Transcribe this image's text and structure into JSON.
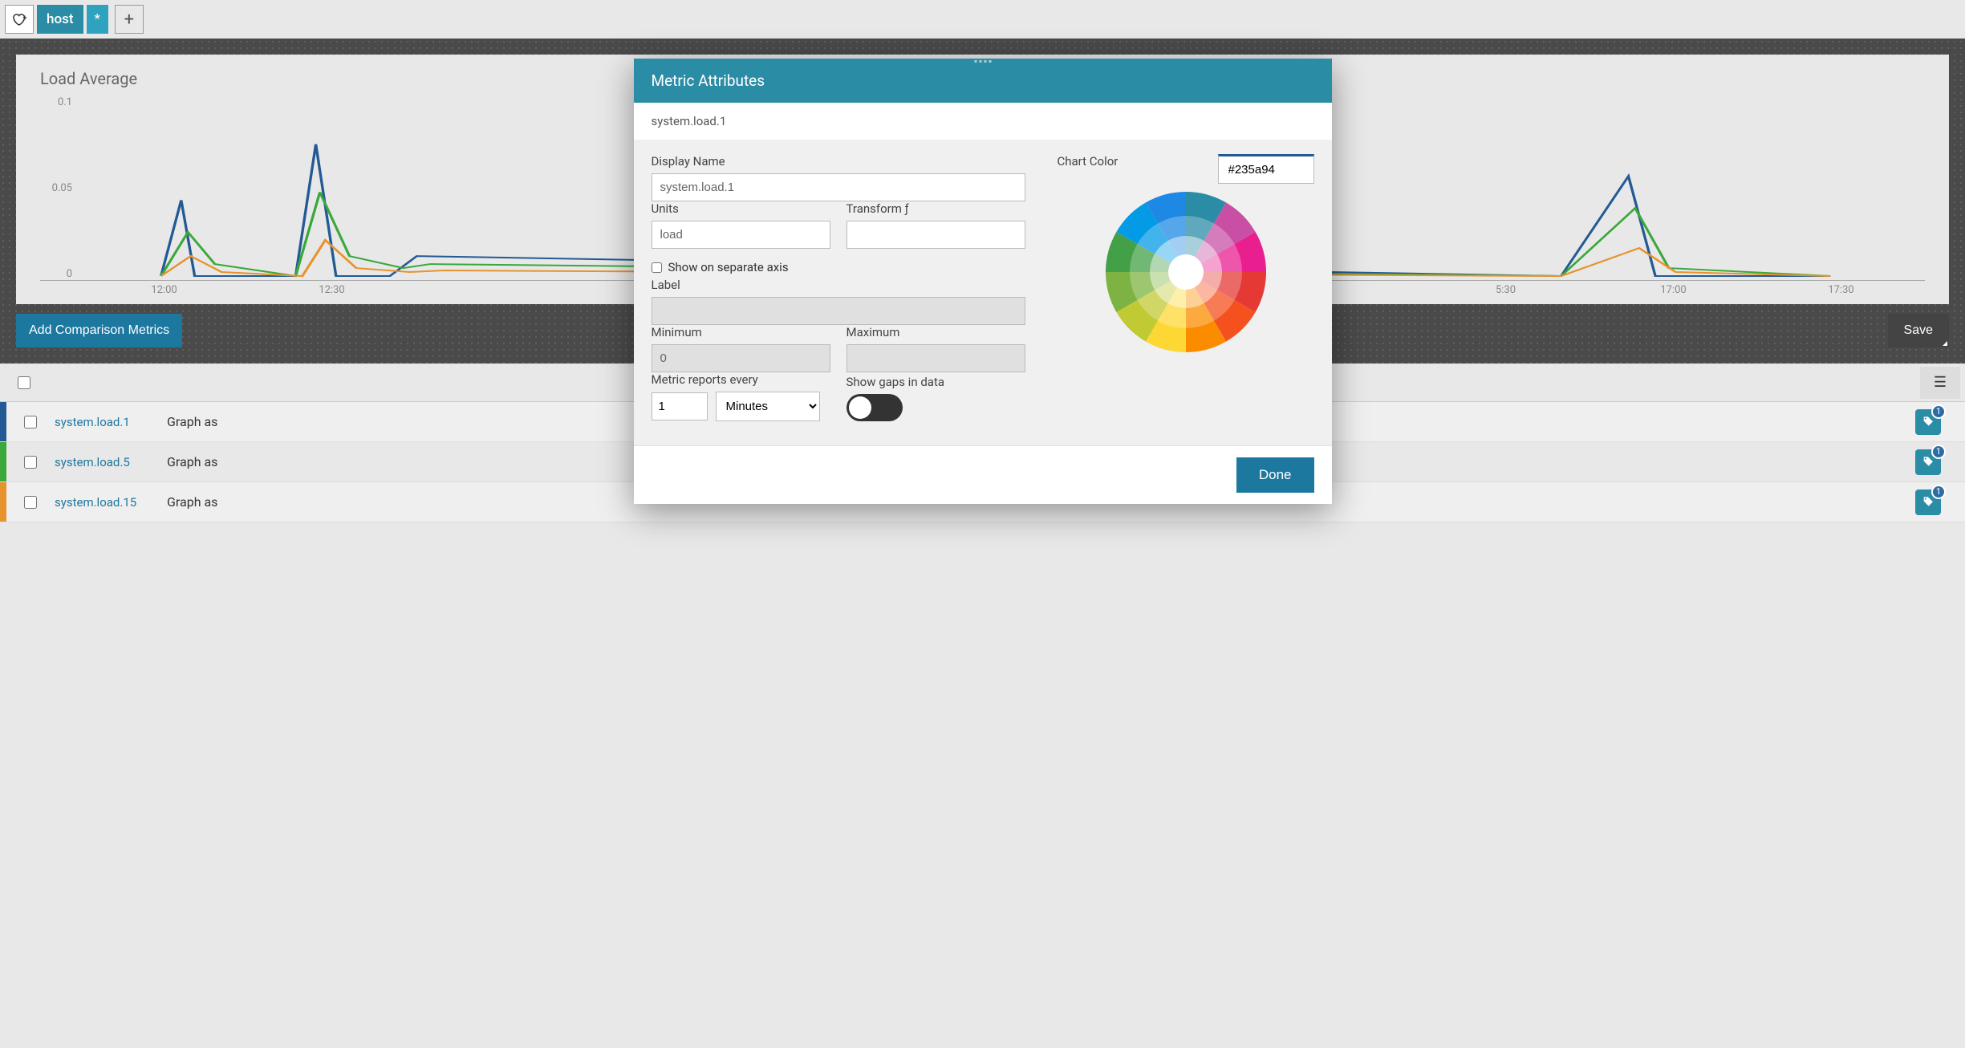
{
  "tabs": {
    "host_label": "host",
    "star_label": "*"
  },
  "chart": {
    "title": "Load Average"
  },
  "chart_data": {
    "type": "line",
    "title": "Load Average",
    "ylabel": "",
    "xlabel": "",
    "ylim": [
      0,
      0.1
    ],
    "yticks": [
      "0.1",
      "0.05",
      "0"
    ],
    "xticks": [
      "12:00",
      "12:30",
      "5:30",
      "17:00",
      "17:30"
    ],
    "series": [
      {
        "name": "system.load.1",
        "color": "#235a94"
      },
      {
        "name": "system.load.5",
        "color": "#3aa83a"
      },
      {
        "name": "system.load.15",
        "color": "#e6932e"
      }
    ]
  },
  "actions": {
    "add_comparison": "Add Comparison Metrics",
    "save": "Save"
  },
  "metrics": [
    {
      "name": "system.load.1",
      "graph_as": "Graph as",
      "color": "#235a94",
      "tag_count": "1"
    },
    {
      "name": "system.load.5",
      "graph_as": "Graph as",
      "color": "#3aa83a",
      "tag_count": "1"
    },
    {
      "name": "system.load.15",
      "graph_as": "Graph as",
      "color": "#e6932e",
      "tag_count": "1"
    }
  ],
  "modal": {
    "title": "Metric Attributes",
    "metric_name": "system.load.1",
    "labels": {
      "display_name": "Display Name",
      "units": "Units",
      "transform": "Transform ƒ",
      "separate_axis": "Show on separate axis",
      "label": "Label",
      "minimum": "Minimum",
      "maximum": "Maximum",
      "reports_every": "Metric reports every",
      "show_gaps": "Show gaps in data",
      "chart_color": "Chart Color",
      "done": "Done"
    },
    "values": {
      "display_name": "system.load.1",
      "units": "load",
      "transform": "",
      "label": "",
      "minimum": "0",
      "maximum": "",
      "report_interval": "1",
      "report_unit": "Minutes",
      "chart_color": "#235a94"
    }
  }
}
